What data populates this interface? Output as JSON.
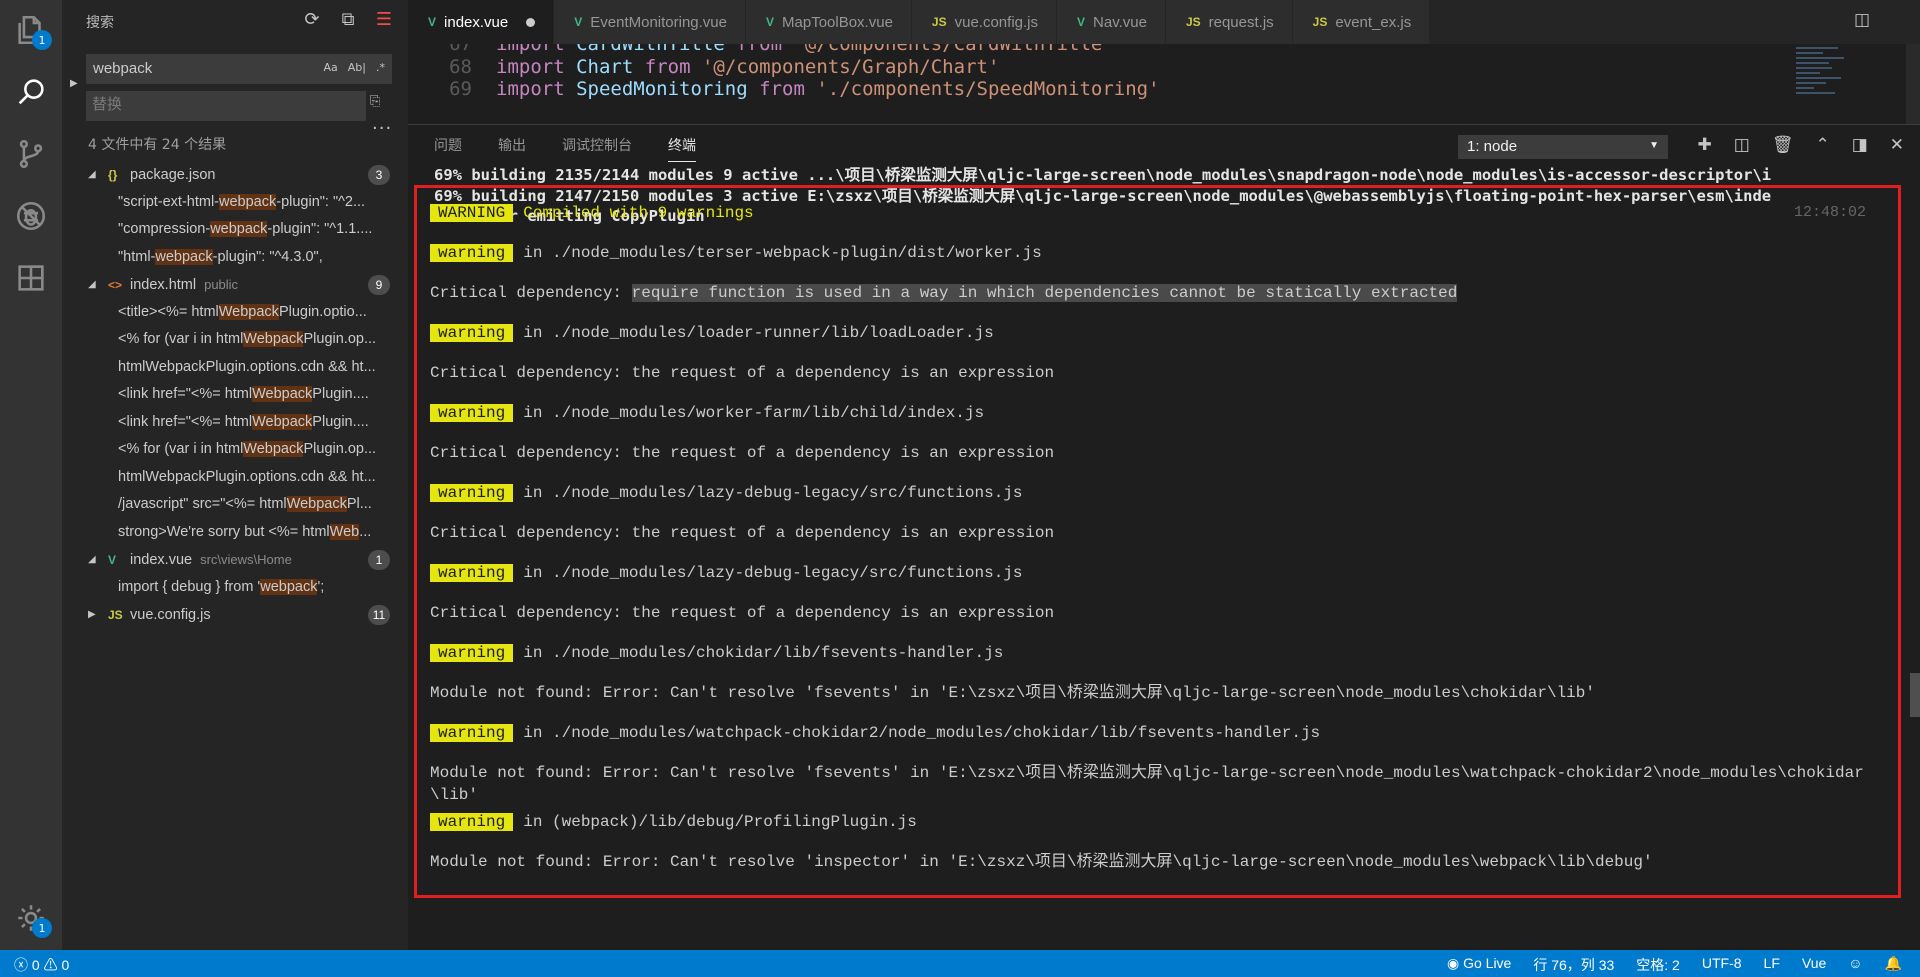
{
  "sidebar": {
    "title": "搜索",
    "search": {
      "value": "webpack",
      "opt_case": "Aa",
      "opt_word": "Ab|",
      "opt_regex": ".*"
    },
    "replace": {
      "placeholder": "替换"
    },
    "summary": "4 文件中有 24 个结果",
    "files": [
      {
        "name": "package.json",
        "icon": "{}",
        "icon_color": "#cbcb41",
        "path": "",
        "count": "3",
        "expanded": true,
        "matches": [
          {
            "pre": "\"script-ext-html-",
            "hl": "webpack",
            "post": "-plugin\": \"^2..."
          },
          {
            "pre": "\"compression-",
            "hl": "webpack",
            "post": "-plugin\": \"^1.1...."
          },
          {
            "pre": "\"html-",
            "hl": "webpack",
            "post": "-plugin\": \"^4.3.0\","
          }
        ]
      },
      {
        "name": "index.html",
        "icon": "<>",
        "icon_color": "#e37933",
        "path": "public",
        "count": "9",
        "expanded": true,
        "matches": [
          {
            "pre": "<title><%= html",
            "hl": "Webpack",
            "post": "Plugin.optio..."
          },
          {
            "pre": "<% for (var i in html",
            "hl": "Webpack",
            "post": "Plugin.op..."
          },
          {
            "pre": "htmlWebpackPlugin.options.cdn && ht...",
            "hl": "",
            "post": ""
          },
          {
            "pre": "<link href=\"<%= html",
            "hl": "Webpack",
            "post": "Plugin...."
          },
          {
            "pre": "<link href=\"<%= html",
            "hl": "Webpack",
            "post": "Plugin...."
          },
          {
            "pre": "<% for (var i in html",
            "hl": "Webpack",
            "post": "Plugin.op..."
          },
          {
            "pre": "htmlWebpackPlugin.options.cdn && ht...",
            "hl": "",
            "post": ""
          },
          {
            "pre": "/javascript\" src=\"<%= html",
            "hl": "Webpack",
            "post": "Pl..."
          },
          {
            "pre": "strong>We're sorry but <%= html",
            "hl": "Web",
            "post": "..."
          }
        ]
      },
      {
        "name": "index.vue",
        "icon": "V",
        "icon_color": "#41b883",
        "path": "src\\views\\Home",
        "count": "1",
        "expanded": true,
        "matches": [
          {
            "pre": "import { debug } from '",
            "hl": "webpack",
            "post": "';"
          }
        ]
      },
      {
        "name": "vue.config.js",
        "icon": "JS",
        "icon_color": "#cbcb41",
        "path": "",
        "count": "11",
        "expanded": false,
        "matches": []
      }
    ]
  },
  "activity": {
    "explorer_badge": "1",
    "settings_badge": "1"
  },
  "tabs": [
    {
      "label": "index.vue",
      "icon": "V",
      "icon_color": "#41b883",
      "active": true,
      "dirty": true
    },
    {
      "label": "EventMonitoring.vue",
      "icon": "V",
      "icon_color": "#41b883",
      "active": false,
      "dirty": false
    },
    {
      "label": "MapToolBox.vue",
      "icon": "V",
      "icon_color": "#41b883",
      "active": false,
      "dirty": false
    },
    {
      "label": "vue.config.js",
      "icon": "JS",
      "icon_color": "#cbcb41",
      "active": false,
      "dirty": false
    },
    {
      "label": "Nav.vue",
      "icon": "V",
      "icon_color": "#41b883",
      "active": false,
      "dirty": false
    },
    {
      "label": "request.js",
      "icon": "JS",
      "icon_color": "#cbcb41",
      "active": false,
      "dirty": false
    },
    {
      "label": "event_ex.js",
      "icon": "JS",
      "icon_color": "#cbcb41",
      "active": false,
      "dirty": false
    }
  ],
  "code": [
    {
      "ln": "67",
      "kw": "import",
      "id": "CardWithTitle",
      "from": "from",
      "str": "'@/components/CardWithTitle'"
    },
    {
      "ln": "68",
      "kw": "import",
      "id": "Chart",
      "from": "from",
      "str": "'@/components/Graph/Chart'"
    },
    {
      "ln": "69",
      "kw": "import",
      "id": "SpeedMonitoring",
      "from": "from",
      "str": "'./components/SpeedMonitoring'"
    }
  ],
  "panel": {
    "tabs": [
      "问题",
      "输出",
      "调试控制台",
      "终端"
    ],
    "active_tab": "终端",
    "terminal_select": "1: node"
  },
  "terminal": {
    "build_lines": [
      "69% building 2135/2144 modules 9 active ...\\项目\\桥梁监测大屏\\qljc-large-screen\\node_modules\\snapdragon-node\\node_modules\\is-accessor-descriptor\\i",
      "69% building 2147/2150 modules 3 active E:\\zsxz\\项目\\桥梁监测大屏\\qljc-large-screen\\node_modules\\@webassemblyjs\\floating-point-hex-parser\\esm\\inde",
      "98% after emitting CopyPlugin"
    ],
    "header": {
      "badge": "WARNING",
      "text": "Compiled with 9 warnings",
      "time": "12:48:02"
    },
    "entries": [
      {
        "badge": "warning",
        "path": "in ./node_modules/terser-webpack-plugin/dist/worker.js",
        "msg_pre": "Critical dependency: ",
        "msg_sel": "require function is used in a way in which dependencies cannot be statically extracted"
      },
      {
        "badge": "warning",
        "path": "in ./node_modules/loader-runner/lib/loadLoader.js",
        "msg_pre": "Critical dependency: the request of a dependency is an expression",
        "msg_sel": ""
      },
      {
        "badge": "warning",
        "path": "in ./node_modules/worker-farm/lib/child/index.js",
        "msg_pre": "Critical dependency: the request of a dependency is an expression",
        "msg_sel": ""
      },
      {
        "badge": "warning",
        "path": "in ./node_modules/lazy-debug-legacy/src/functions.js",
        "msg_pre": "Critical dependency: the request of a dependency is an expression",
        "msg_sel": ""
      },
      {
        "badge": "warning",
        "path": "in ./node_modules/lazy-debug-legacy/src/functions.js",
        "msg_pre": "Critical dependency: the request of a dependency is an expression",
        "msg_sel": ""
      },
      {
        "badge": "warning",
        "path": "in ./node_modules/chokidar/lib/fsevents-handler.js",
        "msg_pre": "Module not found: Error: Can't resolve 'fsevents' in 'E:\\zsxz\\项目\\桥梁监测大屏\\qljc-large-screen\\node_modules\\chokidar\\lib'",
        "msg_sel": ""
      },
      {
        "badge": "warning",
        "path": "in ./node_modules/watchpack-chokidar2/node_modules/chokidar/lib/fsevents-handler.js",
        "msg_pre": "Module not found: Error: Can't resolve 'fsevents' in 'E:\\zsxz\\项目\\桥梁监测大屏\\qljc-large-screen\\node_modules\\watchpack-chokidar2\\node_modules\\chokidar\\lib'",
        "msg_sel": ""
      },
      {
        "badge": "warning",
        "path": "in (webpack)/lib/debug/ProfilingPlugin.js",
        "msg_pre": "Module not found: Error: Can't resolve 'inspector' in 'E:\\zsxz\\项目\\桥梁监测大屏\\qljc-large-screen\\node_modules\\webpack\\lib\\debug'",
        "msg_sel": ""
      }
    ]
  },
  "statusbar": {
    "errors": "0",
    "warnings": "0",
    "golive": "Go Live",
    "position": "行 76，列 33",
    "spaces": "空格: 2",
    "encoding": "UTF-8",
    "eol": "LF",
    "language": "Vue"
  }
}
